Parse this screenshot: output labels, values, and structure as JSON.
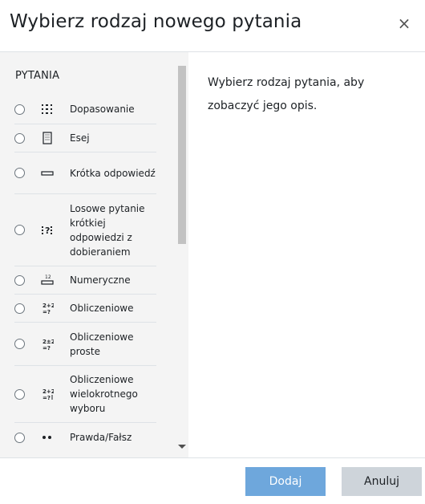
{
  "dialog": {
    "title": "Wybierz rodzaj nowego pytania",
    "close_symbol": "×"
  },
  "options_panel": {
    "heading": "PYTANIA",
    "items": [
      {
        "label": "Dopasowanie",
        "icon": "matching-icon"
      },
      {
        "label": "Esej",
        "icon": "essay-icon"
      },
      {
        "label": "Krótka odpowiedź",
        "icon": "short-answer-icon"
      },
      {
        "label": "Losowe pytanie krótkiej odpowiedzi z dobieraniem",
        "icon": "random-short-answer-matching-icon"
      },
      {
        "label": "Numeryczne",
        "icon": "numerical-icon"
      },
      {
        "label": "Obliczeniowe",
        "icon": "calculated-icon"
      },
      {
        "label": "Obliczeniowe proste",
        "icon": "calculated-simple-icon"
      },
      {
        "label": "Obliczeniowe wielokrotnego wyboru",
        "icon": "calculated-multichoice-icon"
      },
      {
        "label": "Prawda/Fałsz",
        "icon": "true-false-icon"
      }
    ]
  },
  "description": {
    "text": "Wybierz rodzaj pytania, aby zobaczyć jego opis."
  },
  "footer": {
    "add_label": "Dodaj",
    "cancel_label": "Anuluj"
  },
  "colors": {
    "primary_button": "#6ea7dc",
    "secondary_button": "#ced4da",
    "panel_background": "#f4f4f4"
  }
}
